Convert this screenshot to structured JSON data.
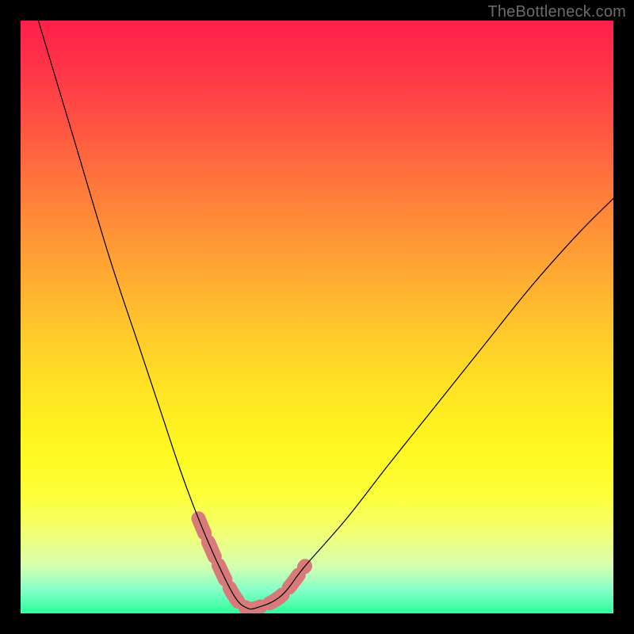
{
  "watermark": {
    "text": "TheBottleneck.com"
  },
  "colors": {
    "frame": "#000000",
    "curve": "#000000",
    "highlight": "#d97a7a",
    "gradient_stops": [
      "#ff1f4a",
      "#ff3a47",
      "#ff6a3e",
      "#ff9a35",
      "#ffc72c",
      "#ffe324",
      "#fff81f",
      "#fdff3a",
      "#f3ff6f",
      "#d6ffb0",
      "#86ffc8",
      "#2bff9a"
    ]
  },
  "chart_data": {
    "type": "line",
    "title": "",
    "xlabel": "",
    "ylabel": "",
    "xlim": [
      0,
      100
    ],
    "ylim": [
      0,
      100
    ],
    "grid": false,
    "legend": false,
    "series": [
      {
        "name": "bottleneck-curve",
        "x": [
          3,
          9,
          15,
          20,
          24,
          27,
          30,
          33,
          36,
          38,
          40,
          44,
          48,
          55,
          62,
          70,
          78,
          86,
          94,
          100
        ],
        "y": [
          100,
          80,
          60,
          45,
          33,
          24,
          16,
          9,
          3,
          1,
          1,
          3,
          8,
          16,
          25,
          35,
          45,
          55,
          64,
          70
        ]
      }
    ],
    "annotations": [
      {
        "name": "valley-highlight",
        "type": "segment",
        "x_range": [
          31,
          46
        ],
        "style": "dashed-thick"
      }
    ]
  }
}
